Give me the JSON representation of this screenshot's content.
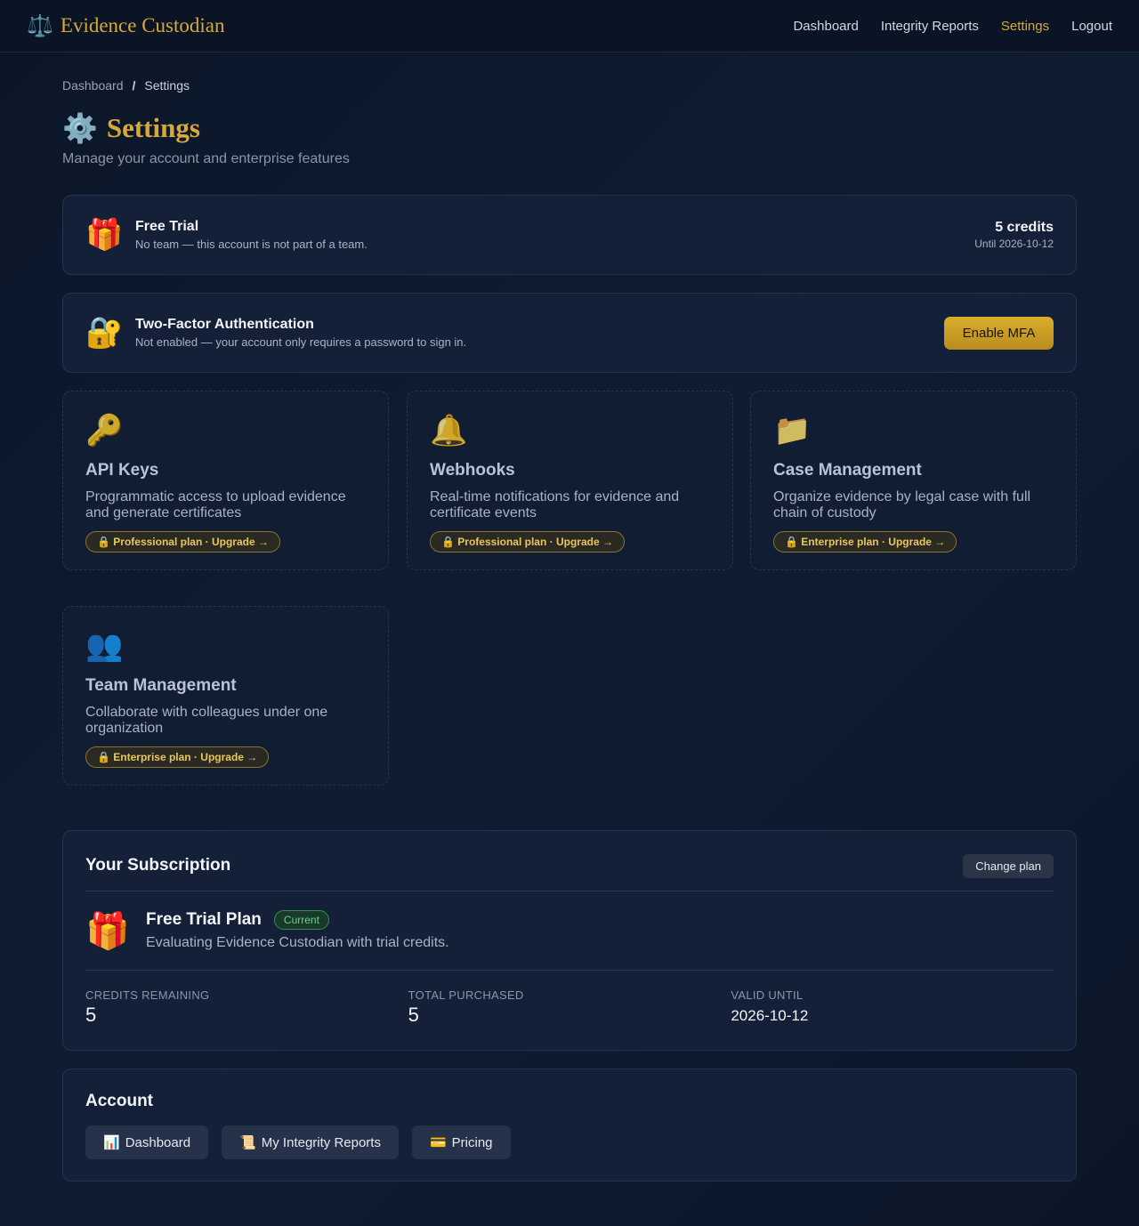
{
  "header": {
    "brand_icon": "⚖️",
    "brand_name": "Evidence Custodian",
    "nav": [
      "Dashboard",
      "Integrity Reports",
      "Settings",
      "Logout"
    ]
  },
  "breadcrumb": {
    "root": "Dashboard",
    "sep": "/",
    "current": "Settings"
  },
  "page": {
    "icon": "⚙️",
    "title": "Settings",
    "subtitle": "Manage your account and enterprise features"
  },
  "trial": {
    "icon": "🎁",
    "title": "Free Trial",
    "desc": "No team — this account is not part of a team.",
    "credits": "5 credits",
    "until": "Until 2026-10-12"
  },
  "mfa": {
    "icon": "🔐",
    "title": "Two-Factor Authentication",
    "desc": "Not enabled — your account only requires a password to sign in.",
    "button": "Enable MFA"
  },
  "features": [
    {
      "icon": "🔑",
      "title": "API Keys",
      "desc": "Programmatic access to upload evidence and generate certificates",
      "badge": "🔒 Professional plan · Upgrade →"
    },
    {
      "icon": "🔔",
      "title": "Webhooks",
      "desc": "Real-time notifications for evidence and certificate events",
      "badge": "🔒 Professional plan · Upgrade →"
    },
    {
      "icon": "📁",
      "title": "Case Management",
      "desc": "Organize evidence by legal case with full chain of custody",
      "badge": "🔒 Enterprise plan · Upgrade →"
    },
    {
      "icon": "👥",
      "title": "Team Management",
      "desc": "Collaborate with colleagues under one organization",
      "badge": "🔒 Enterprise plan · Upgrade →"
    }
  ],
  "subscription": {
    "title": "Your Subscription",
    "change_button": "Change plan",
    "plan_icon": "🎁",
    "plan_name": "Free Trial Plan",
    "current_badge": "Current",
    "plan_desc": "Evaluating Evidence Custodian with trial credits.",
    "stats": [
      {
        "label": "CREDITS REMAINING",
        "value": "5"
      },
      {
        "label": "TOTAL PURCHASED",
        "value": "5"
      },
      {
        "label": "VALID UNTIL",
        "value": "2026-10-12"
      }
    ]
  },
  "account": {
    "title": "Account",
    "links": [
      {
        "icon": "📊",
        "label": "Dashboard"
      },
      {
        "icon": "📜",
        "label": "My Integrity Reports"
      },
      {
        "icon": "💳",
        "label": "Pricing"
      }
    ]
  }
}
